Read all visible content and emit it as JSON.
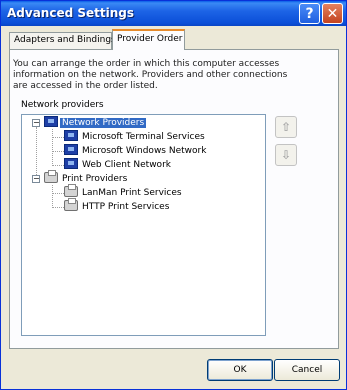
{
  "window": {
    "title": "Advanced Settings"
  },
  "titlebar": {
    "help_glyph": "?",
    "close_glyph": "✕"
  },
  "tabs": [
    {
      "label": "Adapters and Bindings"
    },
    {
      "label": "Provider Order"
    }
  ],
  "description": "You can arrange the order in which this computer accesses information on the network. Providers and other connections are accessed in the order listed.",
  "network_providers_label": "Network providers",
  "tree": {
    "groups": [
      {
        "label": "Network Providers",
        "icon": "network-icon",
        "expanded": true,
        "selected": true,
        "children": [
          {
            "label": "Microsoft Terminal Services",
            "icon": "network-icon"
          },
          {
            "label": "Microsoft Windows Network",
            "icon": "network-icon"
          },
          {
            "label": "Web Client Network",
            "icon": "network-icon"
          }
        ]
      },
      {
        "label": "Print Providers",
        "icon": "printer-icon",
        "expanded": true,
        "selected": false,
        "children": [
          {
            "label": "LanMan Print Services",
            "icon": "printer-icon"
          },
          {
            "label": "HTTP Print Services",
            "icon": "printer-icon"
          }
        ]
      }
    ],
    "expander_glyph": "−"
  },
  "arrows": {
    "up_glyph": "⇧",
    "down_glyph": "⇩"
  },
  "buttons": {
    "ok": "OK",
    "cancel": "Cancel"
  },
  "colors": {
    "titlebar": "#0a5ee8",
    "selection": "#316ac5",
    "dialog_bg": "#ece9d8",
    "tab_accent": "#e68b2c"
  }
}
